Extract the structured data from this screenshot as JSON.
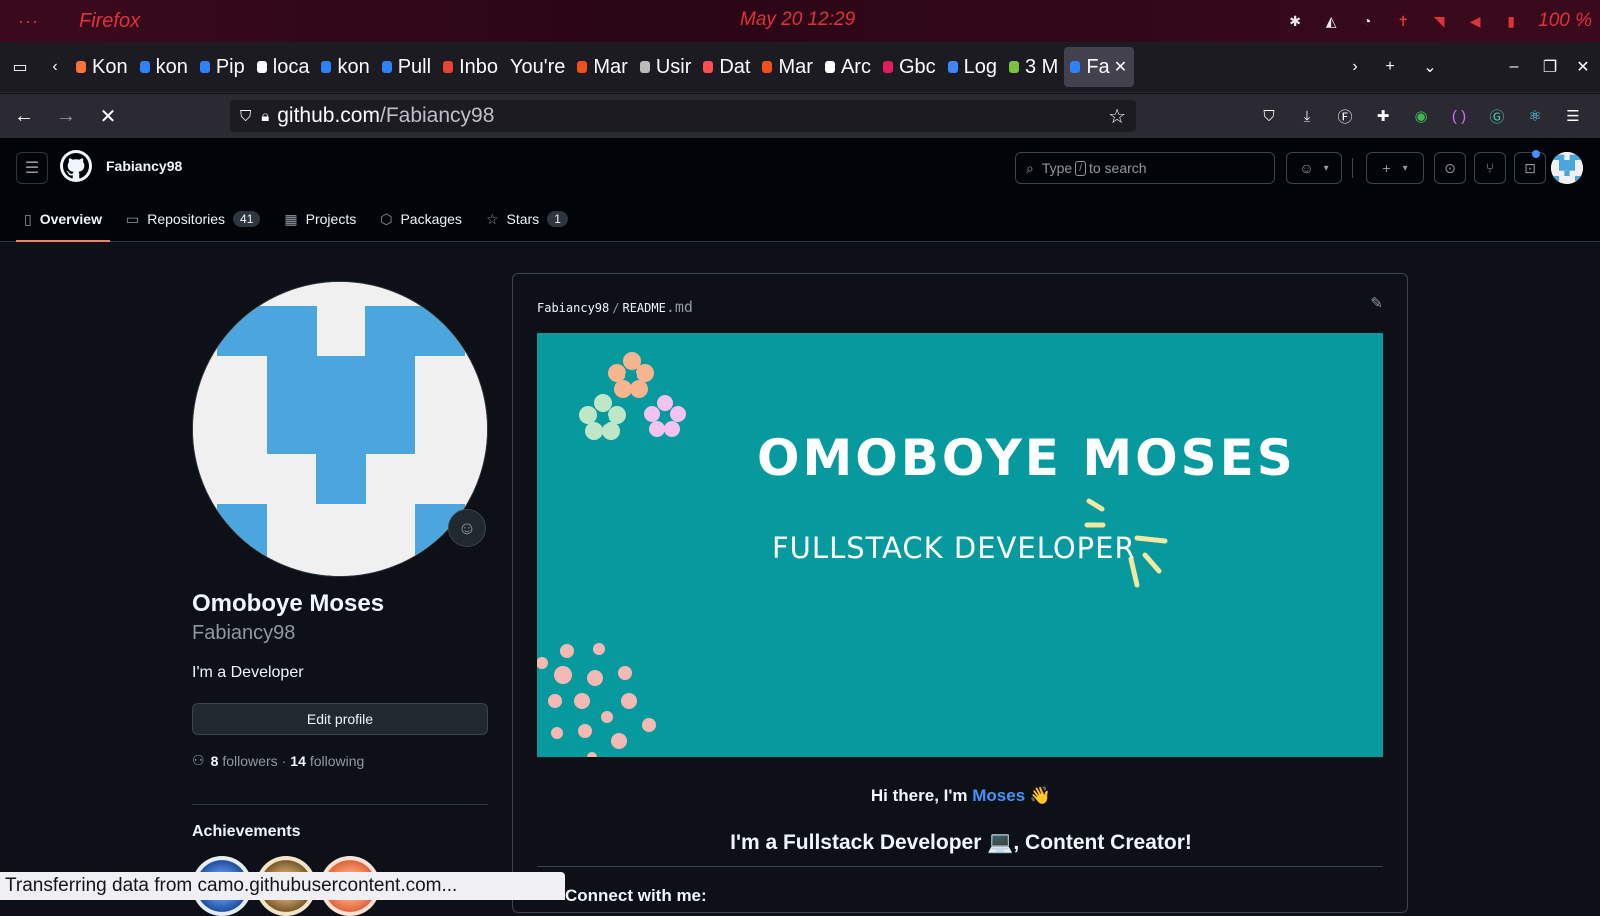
{
  "os": {
    "dots": "···",
    "app_name": "Firefox",
    "clock": "May 20  12:29",
    "battery": "100 %"
  },
  "tabs": [
    {
      "label": "Kon",
      "color": "#ff7139"
    },
    {
      "label": "kon",
      "color": "#2f81f7"
    },
    {
      "label": "Pip",
      "color": "#2f81f7"
    },
    {
      "label": "loca",
      "color": "#fbfbfe"
    },
    {
      "label": "kon",
      "color": "#2f81f7"
    },
    {
      "label": "Pull",
      "color": "#2f81f7"
    },
    {
      "label": "Inbo",
      "color": "#ea4335"
    },
    {
      "label": "You're",
      "color": ""
    },
    {
      "label": "Mar",
      "color": "#f24e1e"
    },
    {
      "label": "Usir",
      "color": "#bbbbbb"
    },
    {
      "label": "Dat",
      "color": "#ff4f4f"
    },
    {
      "label": "Mar",
      "color": "#f24e1e"
    },
    {
      "label": "Arc",
      "color": "#ffffff"
    },
    {
      "label": "Gbc",
      "color": "#e01e5a"
    },
    {
      "label": "Log",
      "color": "#4285f4"
    },
    {
      "label": "3 M",
      "color": "#7cc242"
    },
    {
      "label": "Fa",
      "color": "#2f81f7",
      "active": true
    }
  ],
  "nav": {
    "url_host": "github.com",
    "url_path": "/Fabiancy98"
  },
  "gh": {
    "username": "Fabiancy98",
    "search_prefix": "Type",
    "search_key": "/",
    "search_suffix": "to search",
    "tabs": [
      {
        "label": "Overview",
        "icon": "book-icon",
        "glyph": "▯",
        "active": true
      },
      {
        "label": "Repositories",
        "icon": "repo-icon",
        "glyph": "▭",
        "count": "41"
      },
      {
        "label": "Projects",
        "icon": "table-icon",
        "glyph": "▦"
      },
      {
        "label": "Packages",
        "icon": "package-icon",
        "glyph": "⬡"
      },
      {
        "label": "Stars",
        "icon": "star-icon",
        "glyph": "☆",
        "count": "1"
      }
    ]
  },
  "profile": {
    "name": "Omoboye Moses",
    "login": "Fabiancy98",
    "bio": "I'm a Developer",
    "edit_label": "Edit profile",
    "followers_count": "8",
    "followers_label": "followers",
    "sep": "·",
    "following_count": "14",
    "following_label": "following",
    "achievements_title": "Achievements"
  },
  "readme": {
    "owner": "Fabiancy98",
    "slash": "/",
    "file": "README",
    "ext": ".md",
    "banner_name": "OMOBOYE MOSES",
    "banner_role": "FULLSTACK DEVELOPER",
    "hi_prefix": "Hi there, I'm",
    "hi_name": "Moses",
    "hi_emoji": "👋",
    "role_line": "I'm a Fullstack Developer 💻, Content Creator!",
    "connect": "Connect with me:"
  },
  "status_text": "Transferring data from camo.githubusercontent.com..."
}
